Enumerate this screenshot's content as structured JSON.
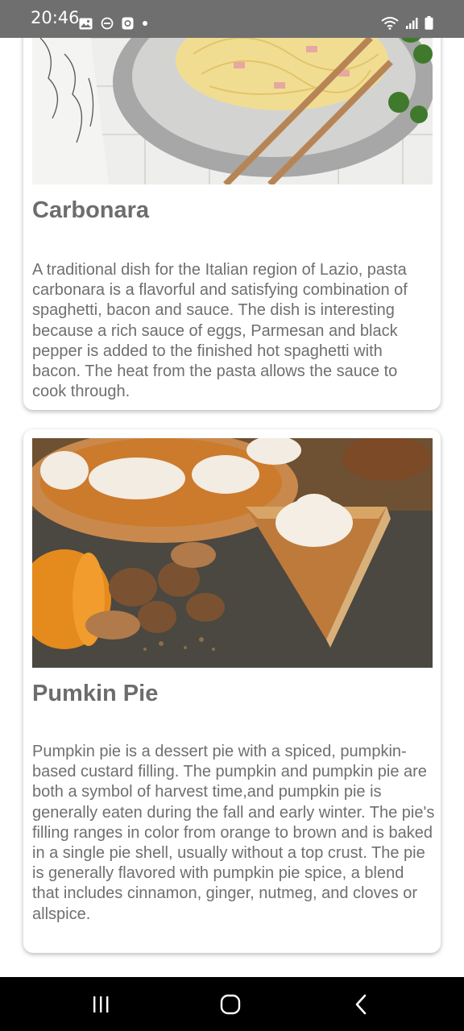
{
  "status_bar": {
    "time": "20:46",
    "left_icons": [
      "gallery-icon",
      "do-not-disturb-icon",
      "app-notification-icon",
      "dot-icon"
    ],
    "right_icons": [
      "wifi-icon",
      "signal-icon",
      "battery-icon"
    ]
  },
  "recipes": [
    {
      "title": "Carbonara",
      "description": "A traditional dish for the Italian region of Lazio, pasta carbonara is a flavorful and satisfying combination of spaghetti, bacon and sauce. The dish is interesting because a rich sauce of eggs, Parmesan and black pepper is added to the finished hot spaghetti with bacon. The heat from the pasta allows the sauce to cook through."
    },
    {
      "title": "Pumkin Pie",
      "description": "Pumpkin pie is a dessert pie with a spiced, pumpkin-based custard filling. The pumpkin and pumpkin pie are both a symbol of harvest time,and pumpkin pie is generally eaten during the fall and early winter. The pie's filling ranges in color from orange to brown and is baked in a single pie shell, usually without a top crust. The pie is generally flavored with pumpkin pie spice, a blend that includes cinnamon, ginger, nutmeg, and cloves or allspice."
    }
  ],
  "nav_bar": {
    "buttons": [
      "recent-apps-icon",
      "home-icon",
      "back-icon"
    ]
  }
}
